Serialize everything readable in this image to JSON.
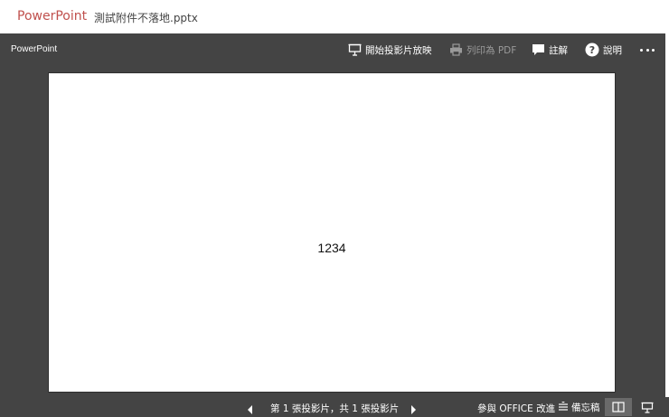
{
  "titlebar": {
    "app_name": "PowerPoint",
    "file_name": "測試附件不落地.pptx"
  },
  "viewer": {
    "label": "PowerPoint",
    "toolbar": {
      "start_slideshow": "開始投影片放映",
      "print_pdf": "列印為 PDF",
      "comments": "註解",
      "help": "說明"
    }
  },
  "slide": {
    "text": "1234"
  },
  "statusbar": {
    "slide_counter": "第 1 張投影片，共 1 張投影片",
    "feedback": "參與 OFFICE 改進",
    "notes": "備忘稿"
  },
  "icons": {
    "start_slideshow": "projector-icon",
    "print_pdf": "printer-icon",
    "comments": "comment-icon",
    "help": "help-icon",
    "more": "more-icon",
    "prev": "triangle-left-icon",
    "next": "triangle-right-icon",
    "notes": "notes-icon",
    "reading_view": "book-icon",
    "slideshow_view": "projector-icon"
  },
  "colors": {
    "brand": "#c0504d",
    "viewer_bg": "#444444",
    "active_view_bg": "#6a6a6a",
    "disabled_text": "#9a9a9a"
  }
}
